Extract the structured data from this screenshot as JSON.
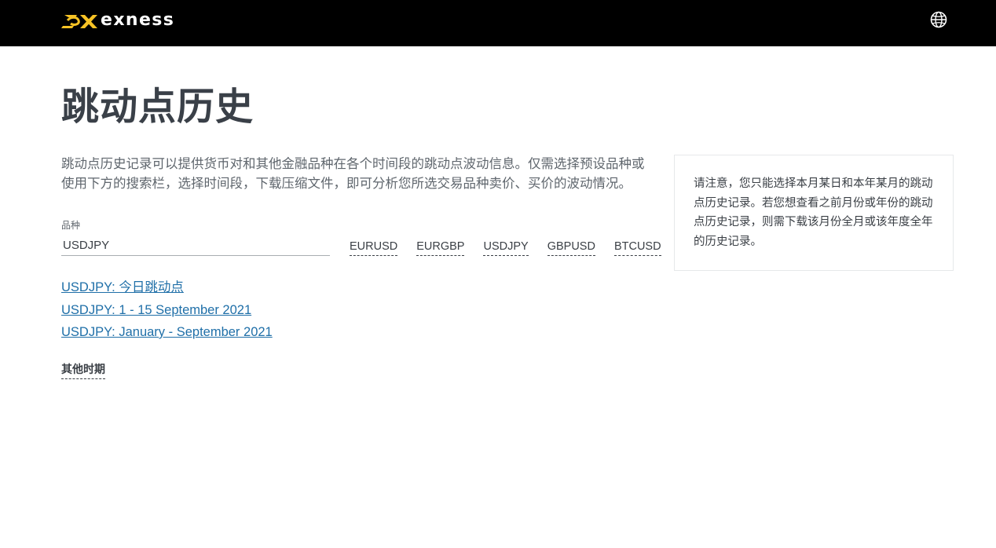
{
  "header": {
    "logo_text": "exness",
    "logo_icon": "exness-logo-icon",
    "language_icon": "globe-icon",
    "brand_color": "#f7c325",
    "background": "#000000"
  },
  "page": {
    "title": "跳动点历史",
    "intro": "跳动点历史记录可以提供货币对和其他金融品种在各个时间段的跳动点波动信息。仅需选择预设品种或使用下方的搜索栏，选择时间段，下载压缩文件，即可分析您所选交易品种卖价、买价的波动情况。"
  },
  "search": {
    "label": "品种",
    "value": "USDJPY",
    "quick_symbols": [
      "EURUSD",
      "EURGBP",
      "USDJPY",
      "GBPUSD",
      "BTCUSD"
    ]
  },
  "downloads": {
    "links": [
      "USDJPY: 今日跳动点",
      "USDJPY: 1 - 15 September 2021",
      "USDJPY: January - September 2021"
    ],
    "link_color": "#1f6fa8",
    "other_periods": "其他时期"
  },
  "note": {
    "text": "请注意，您只能选择本月某日和本年某月的跳动点历史记录。若您想查看之前月份或年份的跳动点历史记录，则需下载该月份全月或该年度全年的历史记录。"
  }
}
